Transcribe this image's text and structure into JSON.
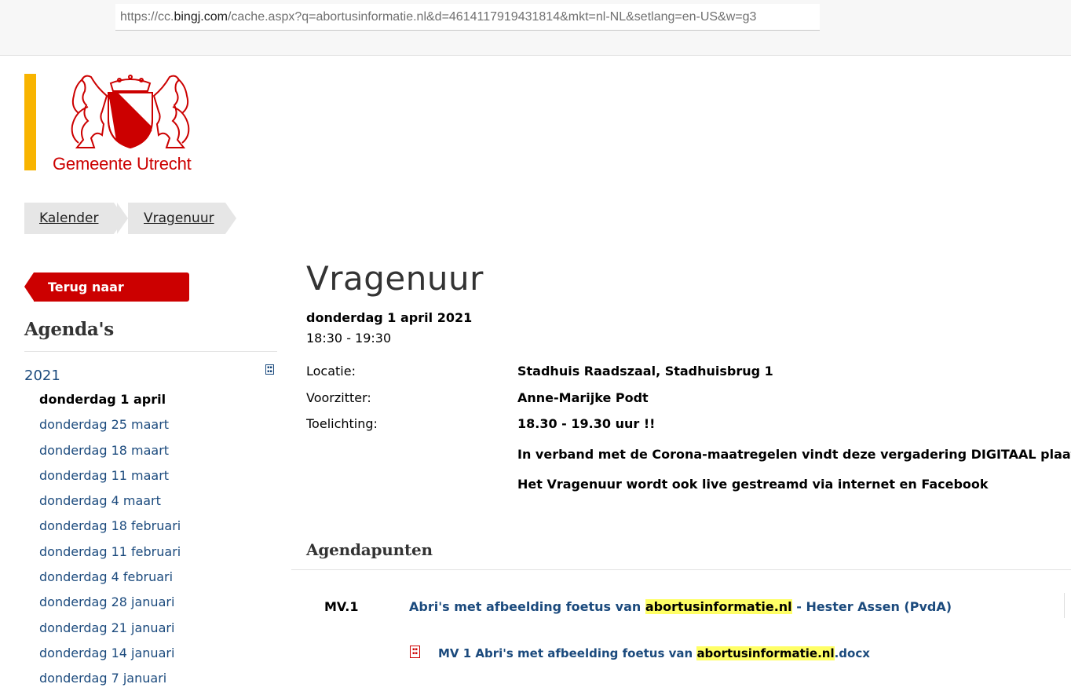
{
  "browser": {
    "url_prefix": "https://cc.",
    "url_domain": "bingj.com",
    "url_rest": "/cache.aspx?q=abortusinformatie.nl&d=4614117919431814&mkt=nl-NL&setlang=en-US&w=g3"
  },
  "logo": {
    "text": "Gemeente Utrecht",
    "brand_color": "#cc0000",
    "accent_color": "#f8b400"
  },
  "breadcrumb": {
    "items": [
      "Kalender",
      "Vragenuur"
    ]
  },
  "sidebar": {
    "back_label": "Terug naar kalender",
    "title": "Agenda's",
    "year": "2021",
    "dates": [
      "donderdag 1 april",
      "donderdag 25 maart",
      "donderdag 18 maart",
      "donderdag 11 maart",
      "donderdag 4 maart",
      "donderdag 18 februari",
      "donderdag 11 februari",
      "donderdag 4 februari",
      "donderdag 28 januari",
      "donderdag 21 januari",
      "donderdag 14 januari",
      "donderdag 7 januari"
    ]
  },
  "meeting": {
    "title": "Vragenuur",
    "date": "donderdag 1 april 2021",
    "time": "18:30 - 19:30",
    "location_label": "Locatie:",
    "location": "Stadhuis Raadszaal, Stadhuisbrug 1",
    "chair_label": "Voorzitter:",
    "chair": "Anne-Marijke Podt",
    "notes_label": "Toelichting:",
    "notes": [
      "18.30 - 19.30 uur !!",
      "In verband met de Corona-maatregelen vindt deze vergadering DIGITAAL plaats",
      "Het Vragenuur wordt ook live gestreamd via internet en Facebook"
    ]
  },
  "agenda": {
    "title": "Agendapunten",
    "items": [
      {
        "code": "MV.1",
        "title_before": "Abri's met afbeelding foetus van ",
        "title_highlight": "abortusinformatie.nl",
        "title_after": " - Hester Assen (PvdA)",
        "file_before": "MV 1 Abri's met afbeelding foetus van ",
        "file_highlight": "abortusinformatie.nl",
        "file_after": ".docx"
      }
    ]
  }
}
